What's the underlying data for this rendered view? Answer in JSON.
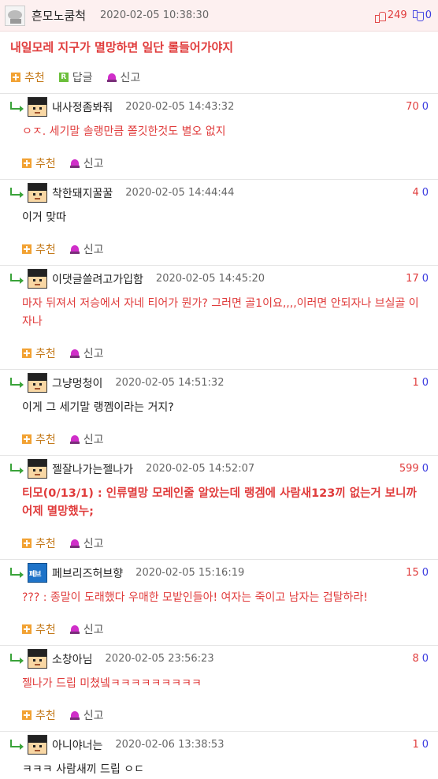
{
  "main": {
    "nickname": "흔모노쿰척",
    "date": "2020-02-05 10:38:30",
    "upvotes": "249",
    "downvotes": "0",
    "body": "내일모레 지구가 멸망하면 일단 롤들어가야지",
    "actions": {
      "recommend": "추천",
      "reply": "답글",
      "report": "신고"
    }
  },
  "comment_actions": {
    "recommend": "추천",
    "report": "신고"
  },
  "comments": [
    {
      "nickname": "내사정좀봐줘",
      "date": "2020-02-05 14:43:32",
      "upvotes": "70",
      "downvotes": "0",
      "body": "ㅇㅈ. 세기말 솔랭만큼 쫄깃한것도 별오 없지"
    },
    {
      "nickname": "착한돼지꿀꿀",
      "date": "2020-02-05 14:44:44",
      "upvotes": "4",
      "downvotes": "0",
      "body": "이거 맞따"
    },
    {
      "nickname": "이댓글쓸려고가입함",
      "date": "2020-02-05 14:45:20",
      "upvotes": "17",
      "downvotes": "0",
      "body": "마자 뒤져서 저승에서 자네 티어가 뭔가? 그러면 골1이요,,,,이러면 안되자나 브실골 이자나"
    },
    {
      "nickname": "그냥멍청이",
      "date": "2020-02-05 14:51:32",
      "upvotes": "1",
      "downvotes": "0",
      "body": "이게 그 세기말 랭껨이라는 거지?"
    },
    {
      "nickname": "젤잘나가는젤나가",
      "date": "2020-02-05 14:52:07",
      "upvotes": "599",
      "downvotes": "0",
      "body": "티모(0/13/1) : 인류멸망 모레인줄 알았는데 랭겜에 사람새123끼 없는거 보니까 어제 멸망했누;"
    },
    {
      "nickname": "페브리즈허브향",
      "date": "2020-02-05 15:16:19",
      "upvotes": "15",
      "downvotes": "0",
      "body": "??? : 종말이 도래했다 우매한 모밭인들아! 여자는 죽이고 남자는 겁탈하라!"
    },
    {
      "nickname": "소창아님",
      "date": "2020-02-05 23:56:23",
      "upvotes": "8",
      "downvotes": "0",
      "body": "젤나가 드립 미쳤넼ㅋㅋㅋㅋㅋㅋㅋㅋㅋ"
    },
    {
      "nickname": "아니야너는",
      "date": "2020-02-06 13:38:53",
      "upvotes": "1",
      "downvotes": "0",
      "body": "ㅋㅋㅋ 사람새끼 드립 ㅇㄷ"
    }
  ],
  "colors": {
    "accent_red": "#e03c3c",
    "down_blue": "#3c3ce0",
    "reply_green": "#3aa33a",
    "recommend_orange": "#f2a233",
    "header_pink": "#fdf0f0"
  }
}
